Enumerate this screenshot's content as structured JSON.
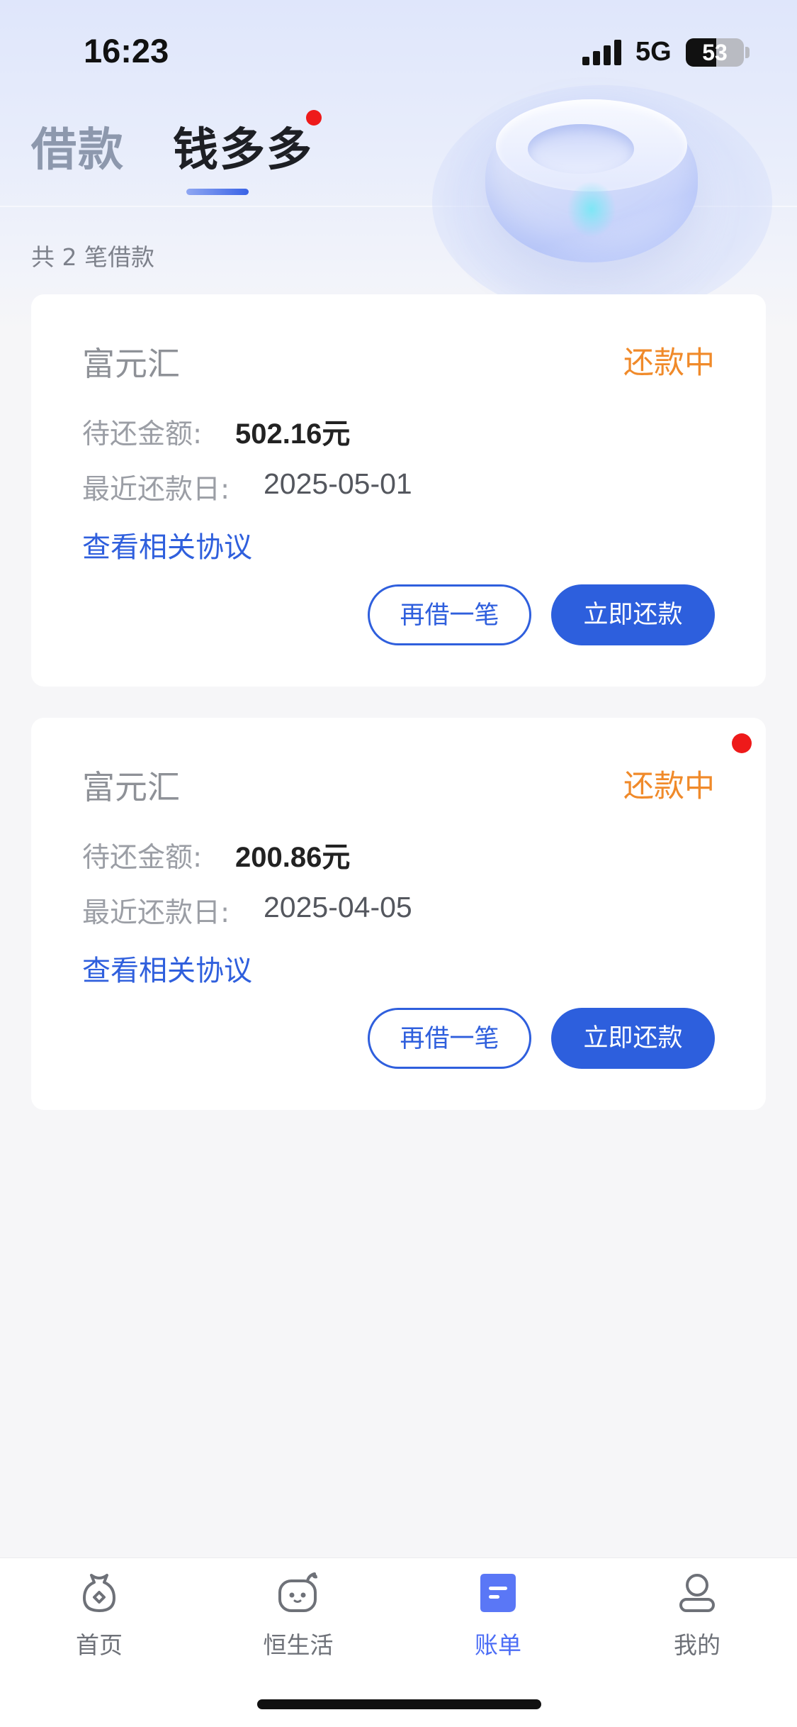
{
  "status_bar": {
    "time": "16:23",
    "network": "5G",
    "battery": "53",
    "battery_level": 0.53
  },
  "tabs": [
    {
      "label": "借款",
      "active": false
    },
    {
      "label": "钱多多",
      "active": true,
      "has_dot": true
    }
  ],
  "summary": "共 2 笔借款",
  "loans": [
    {
      "provider": "富元汇",
      "status": "还款中",
      "amount_label": "待还金额:",
      "amount": "502.16元",
      "date_label": "最近还款日:",
      "date": "2025-05-01",
      "agreement_link": "查看相关协议",
      "borrow_again": "再借一笔",
      "repay_now": "立即还款",
      "has_dot": false
    },
    {
      "provider": "富元汇",
      "status": "还款中",
      "amount_label": "待还金额:",
      "amount": "200.86元",
      "date_label": "最近还款日:",
      "date": "2025-04-05",
      "agreement_link": "查看相关协议",
      "borrow_again": "再借一笔",
      "repay_now": "立即还款",
      "has_dot": true
    }
  ],
  "bottom_nav": [
    {
      "label": "首页",
      "icon": "home-pouch-icon",
      "active": false
    },
    {
      "label": "恒生活",
      "icon": "life-face-icon",
      "active": false
    },
    {
      "label": "账单",
      "icon": "bill-icon",
      "active": true
    },
    {
      "label": "我的",
      "icon": "profile-icon",
      "active": false
    }
  ],
  "colors": {
    "accent": "#2d5fdd",
    "status_orange": "#f08a2a",
    "nav_active": "#4d6ef5",
    "badge_red": "#ee1a1a"
  }
}
